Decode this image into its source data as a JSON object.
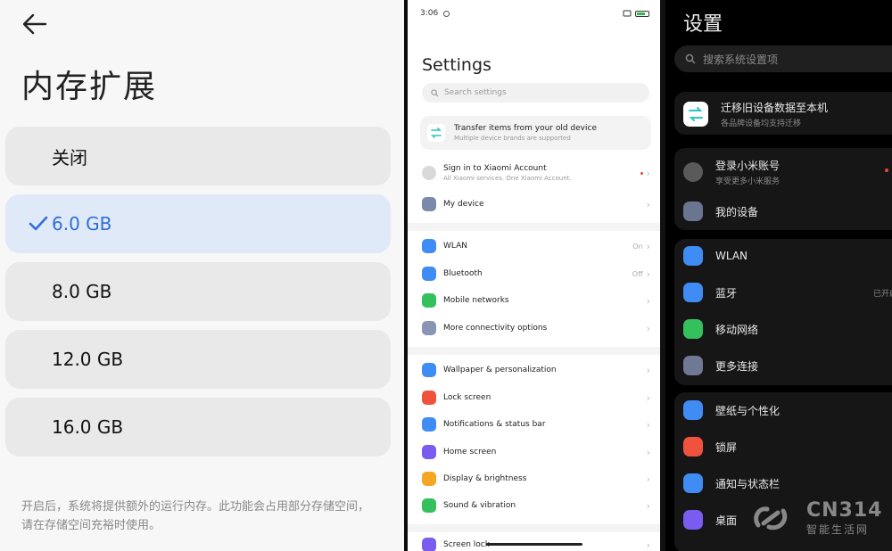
{
  "memory": {
    "title": "内存扩展",
    "options": [
      {
        "label": "关闭",
        "selected": false
      },
      {
        "label": "6.0 GB",
        "selected": true
      },
      {
        "label": "8.0 GB",
        "selected": false
      },
      {
        "label": "12.0 GB",
        "selected": false
      },
      {
        "label": "16.0 GB",
        "selected": false
      }
    ],
    "note": "开启后，系统将提供额外的运行内存。此功能会占用部分存储空间，请在存储空间充裕时使用。",
    "accent": "#2f6fd8"
  },
  "en": {
    "time": "3:06",
    "title": "Settings",
    "search_placeholder": "Search settings",
    "transfer": {
      "title": "Transfer items from your old device",
      "subtitle": "Multiple device brands are supported"
    },
    "account": {
      "title": "Sign in to Xiaomi Account",
      "subtitle": "All Xiaomi services. One Xiaomi Account."
    },
    "my_device": "My device",
    "wlan": {
      "label": "WLAN",
      "value": "On"
    },
    "bluetooth": {
      "label": "Bluetooth",
      "value": "Off"
    },
    "mobile": "Mobile networks",
    "more_conn": "More connectivity options",
    "wallpaper": "Wallpaper & personalization",
    "lock": "Lock screen",
    "notif": "Notifications & status bar",
    "home": "Home screen",
    "display": "Display & brightness",
    "sound": "Sound & vibration",
    "screenlock": "Screen lock"
  },
  "zh": {
    "title": "设置",
    "search_placeholder": "搜索系统设置项",
    "transfer": {
      "title": "迁移旧设备数据至本机",
      "subtitle": "各品牌设备均支持迁移"
    },
    "account": {
      "title": "登录小米账号",
      "subtitle": "享受更多小米服务"
    },
    "my_device": "我的设备",
    "wlan": "WLAN",
    "bluetooth": {
      "label": "蓝牙",
      "value": "已开启"
    },
    "mobile": "移动网络",
    "more_conn": "更多连接",
    "wallpaper": "壁纸与个性化",
    "lock": "锁屏",
    "notif": "通知与状态栏",
    "home": "桌面"
  },
  "watermark": {
    "brand": "CN314",
    "slogan": "智能生活网"
  }
}
